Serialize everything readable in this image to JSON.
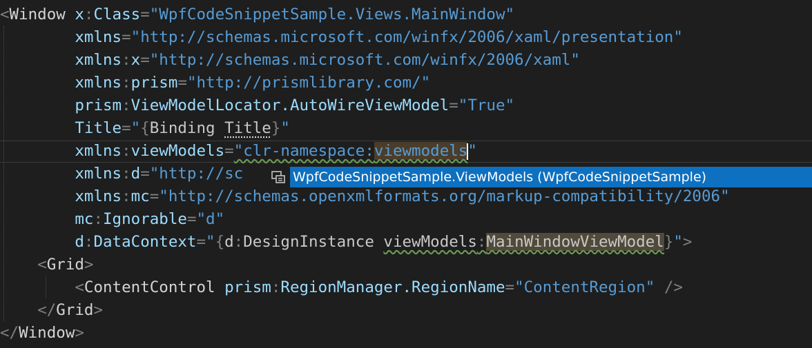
{
  "editor": {
    "lines": [
      {
        "indent": "",
        "parts": [
          {
            "t": "<",
            "c": "p"
          },
          {
            "t": "Window",
            "c": "el"
          },
          {
            "t": " "
          },
          {
            "t": "x",
            "c": "pf"
          },
          {
            "t": ":",
            "c": "p"
          },
          {
            "t": "Class",
            "c": "at"
          },
          {
            "t": "=",
            "c": "p"
          },
          {
            "t": "\"WpfCodeSnippetSample.Views.MainWindow\"",
            "c": "v"
          }
        ]
      },
      {
        "indent": "        ",
        "parts": [
          {
            "t": "xmlns",
            "c": "at"
          },
          {
            "t": "=",
            "c": "p"
          },
          {
            "t": "\"http://schemas.microsoft.com/winfx/2006/xaml/presentation\"",
            "c": "v"
          }
        ]
      },
      {
        "indent": "        ",
        "parts": [
          {
            "t": "xmlns",
            "c": "at"
          },
          {
            "t": ":",
            "c": "p"
          },
          {
            "t": "x",
            "c": "at"
          },
          {
            "t": "=",
            "c": "p"
          },
          {
            "t": "\"http://schemas.microsoft.com/winfx/2006/xaml\"",
            "c": "v"
          }
        ]
      },
      {
        "indent": "        ",
        "parts": [
          {
            "t": "xmlns",
            "c": "at"
          },
          {
            "t": ":",
            "c": "p"
          },
          {
            "t": "prism",
            "c": "at"
          },
          {
            "t": "=",
            "c": "p"
          },
          {
            "t": "\"http://prismlibrary.com/\"",
            "c": "v"
          }
        ]
      },
      {
        "indent": "        ",
        "parts": [
          {
            "t": "prism",
            "c": "at"
          },
          {
            "t": ":",
            "c": "p"
          },
          {
            "t": "ViewModelLocator.AutoWireViewModel",
            "c": "at"
          },
          {
            "t": "=",
            "c": "p"
          },
          {
            "t": "\"True\"",
            "c": "v"
          }
        ]
      },
      {
        "indent": "        ",
        "parts": [
          {
            "t": "Title",
            "c": "at"
          },
          {
            "t": "=",
            "c": "p"
          },
          {
            "t": "\"",
            "c": "v"
          },
          {
            "t": "{",
            "c": "p"
          },
          {
            "t": "Binding ",
            "c": "bx"
          },
          {
            "t": "Title",
            "c": "bx dots"
          },
          {
            "t": "}",
            "c": "p"
          },
          {
            "t": "\"",
            "c": "v"
          }
        ]
      },
      {
        "indent": "        ",
        "parts": [
          {
            "t": "xmlns",
            "c": "at"
          },
          {
            "t": ":",
            "c": "p"
          },
          {
            "t": "viewModels",
            "c": "at"
          },
          {
            "t": "=",
            "c": "p"
          },
          {
            "t": "\"clr-namespace:",
            "c": "v squig"
          },
          {
            "t": "viewmodels",
            "c": "v squig hl"
          },
          {
            "caret": true
          },
          {
            "t": "\"",
            "c": "v"
          }
        ]
      },
      {
        "indent": "        ",
        "parts": [
          {
            "t": "xmlns",
            "c": "at"
          },
          {
            "t": ":",
            "c": "p"
          },
          {
            "t": "d",
            "c": "at"
          },
          {
            "t": "=",
            "c": "p"
          },
          {
            "t": "\"http://sc",
            "c": "v"
          }
        ]
      },
      {
        "indent": "        ",
        "parts": [
          {
            "t": "xmlns",
            "c": "at"
          },
          {
            "t": ":",
            "c": "p"
          },
          {
            "t": "mc",
            "c": "at"
          },
          {
            "t": "=",
            "c": "p"
          },
          {
            "t": "\"http://schemas.openxmlformats.org/markup-compatibility/2006\"",
            "c": "v"
          }
        ]
      },
      {
        "indent": "        ",
        "parts": [
          {
            "t": "mc",
            "c": "at"
          },
          {
            "t": ":",
            "c": "p"
          },
          {
            "t": "Ignorable",
            "c": "at"
          },
          {
            "t": "=",
            "c": "p"
          },
          {
            "t": "\"d\"",
            "c": "v"
          }
        ]
      },
      {
        "indent": "        ",
        "parts": [
          {
            "t": "d",
            "c": "at"
          },
          {
            "t": ":",
            "c": "p"
          },
          {
            "t": "DataContext",
            "c": "at"
          },
          {
            "t": "=",
            "c": "p"
          },
          {
            "t": "\"",
            "c": "v"
          },
          {
            "t": "{",
            "c": "p"
          },
          {
            "t": "d",
            "c": "bx"
          },
          {
            "t": ":",
            "c": "p"
          },
          {
            "t": "DesignInstance ",
            "c": "bx"
          },
          {
            "t": "viewModels",
            "c": "bx squig"
          },
          {
            "t": ":",
            "c": "p squig"
          },
          {
            "t": "MainWindowViewModel",
            "c": "bx squig hl2"
          },
          {
            "t": "}",
            "c": "p"
          },
          {
            "t": "\"",
            "c": "v"
          },
          {
            "t": ">",
            "c": "p"
          }
        ]
      },
      {
        "indent": "    ",
        "parts": [
          {
            "t": "<",
            "c": "p"
          },
          {
            "t": "Grid",
            "c": "el"
          },
          {
            "t": ">",
            "c": "p"
          }
        ]
      },
      {
        "indent": "        ",
        "parts": [
          {
            "t": "<",
            "c": "p"
          },
          {
            "t": "ContentControl",
            "c": "el"
          },
          {
            "t": " "
          },
          {
            "t": "prism",
            "c": "at"
          },
          {
            "t": ":",
            "c": "p"
          },
          {
            "t": "RegionManager.RegionName",
            "c": "at"
          },
          {
            "t": "=",
            "c": "p"
          },
          {
            "t": "\"ContentRegion\"",
            "c": "v"
          },
          {
            "t": " ",
            "c": ""
          },
          {
            "t": "/>",
            "c": "p"
          }
        ]
      },
      {
        "indent": "    ",
        "parts": [
          {
            "t": "</",
            "c": "p"
          },
          {
            "t": "Grid",
            "c": "el"
          },
          {
            "t": ">",
            "c": "p"
          }
        ]
      },
      {
        "indent": "",
        "parts": [
          {
            "t": "</",
            "c": "p"
          },
          {
            "t": "Window",
            "c": "el"
          },
          {
            "t": ">",
            "c": "p"
          }
        ]
      }
    ]
  },
  "completion": {
    "icon": "namespace-icon",
    "item_label": "WpfCodeSnippetSample.ViewModels (WpfCodeSnippetSample)"
  },
  "colors": {
    "background": "#1e1e1e",
    "punctuation": "#808080",
    "attribute": "#9cdcfe",
    "value": "#569cd6",
    "selection": "#0e70c0"
  }
}
